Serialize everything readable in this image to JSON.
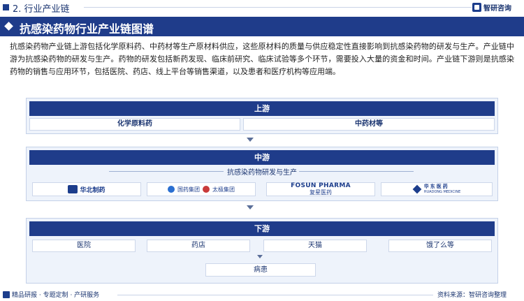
{
  "header": {
    "section_title": "2. 行业产业链",
    "logo_text": "智研咨询"
  },
  "banner": {
    "title": "抗感染药物行业产业链图谱"
  },
  "intro": "抗感染药物产业链上游包括化学原料药、中药材等生产原材料供应，这些原材料的质量与供应稳定性直接影响到抗感染药物的研发与生产。产业链中游为抗感染药物的研发与生产。药物的研发包括新药发现、临床前研究、临床试验等多个环节，需要投入大量的资金和时间。产业链下游则是抗感染药物的销售与应用环节，包括医院、药店、线上平台等销售渠道，以及患者和医疗机构等应用端。",
  "upstream": {
    "label": "上游",
    "items": [
      "化学原料药",
      "中药材等"
    ]
  },
  "midstream": {
    "label": "中游",
    "sub_label": "抗感染药物研发与生产",
    "companies": {
      "huabei": "华北制药",
      "sinopharm": "国药集团",
      "taiji": "太极集团",
      "fosun_en": "FOSUN PHARMA",
      "fosun_cn": "复星医药",
      "huadong_cn": "华东医药",
      "huadong_en": "HUADONG MEDICINE"
    }
  },
  "downstream": {
    "label": "下游",
    "items": [
      "医院",
      "药店",
      "天猫",
      "饿了么等"
    ],
    "end": "病患"
  },
  "footer": {
    "left": "精品研报 · 专题定制 · 产研服务",
    "right": "资料来源：智研咨询整理"
  },
  "colors": {
    "primary": "#1f3c8a",
    "panel_bg": "#eef3fb",
    "border": "#c4d1e8"
  }
}
